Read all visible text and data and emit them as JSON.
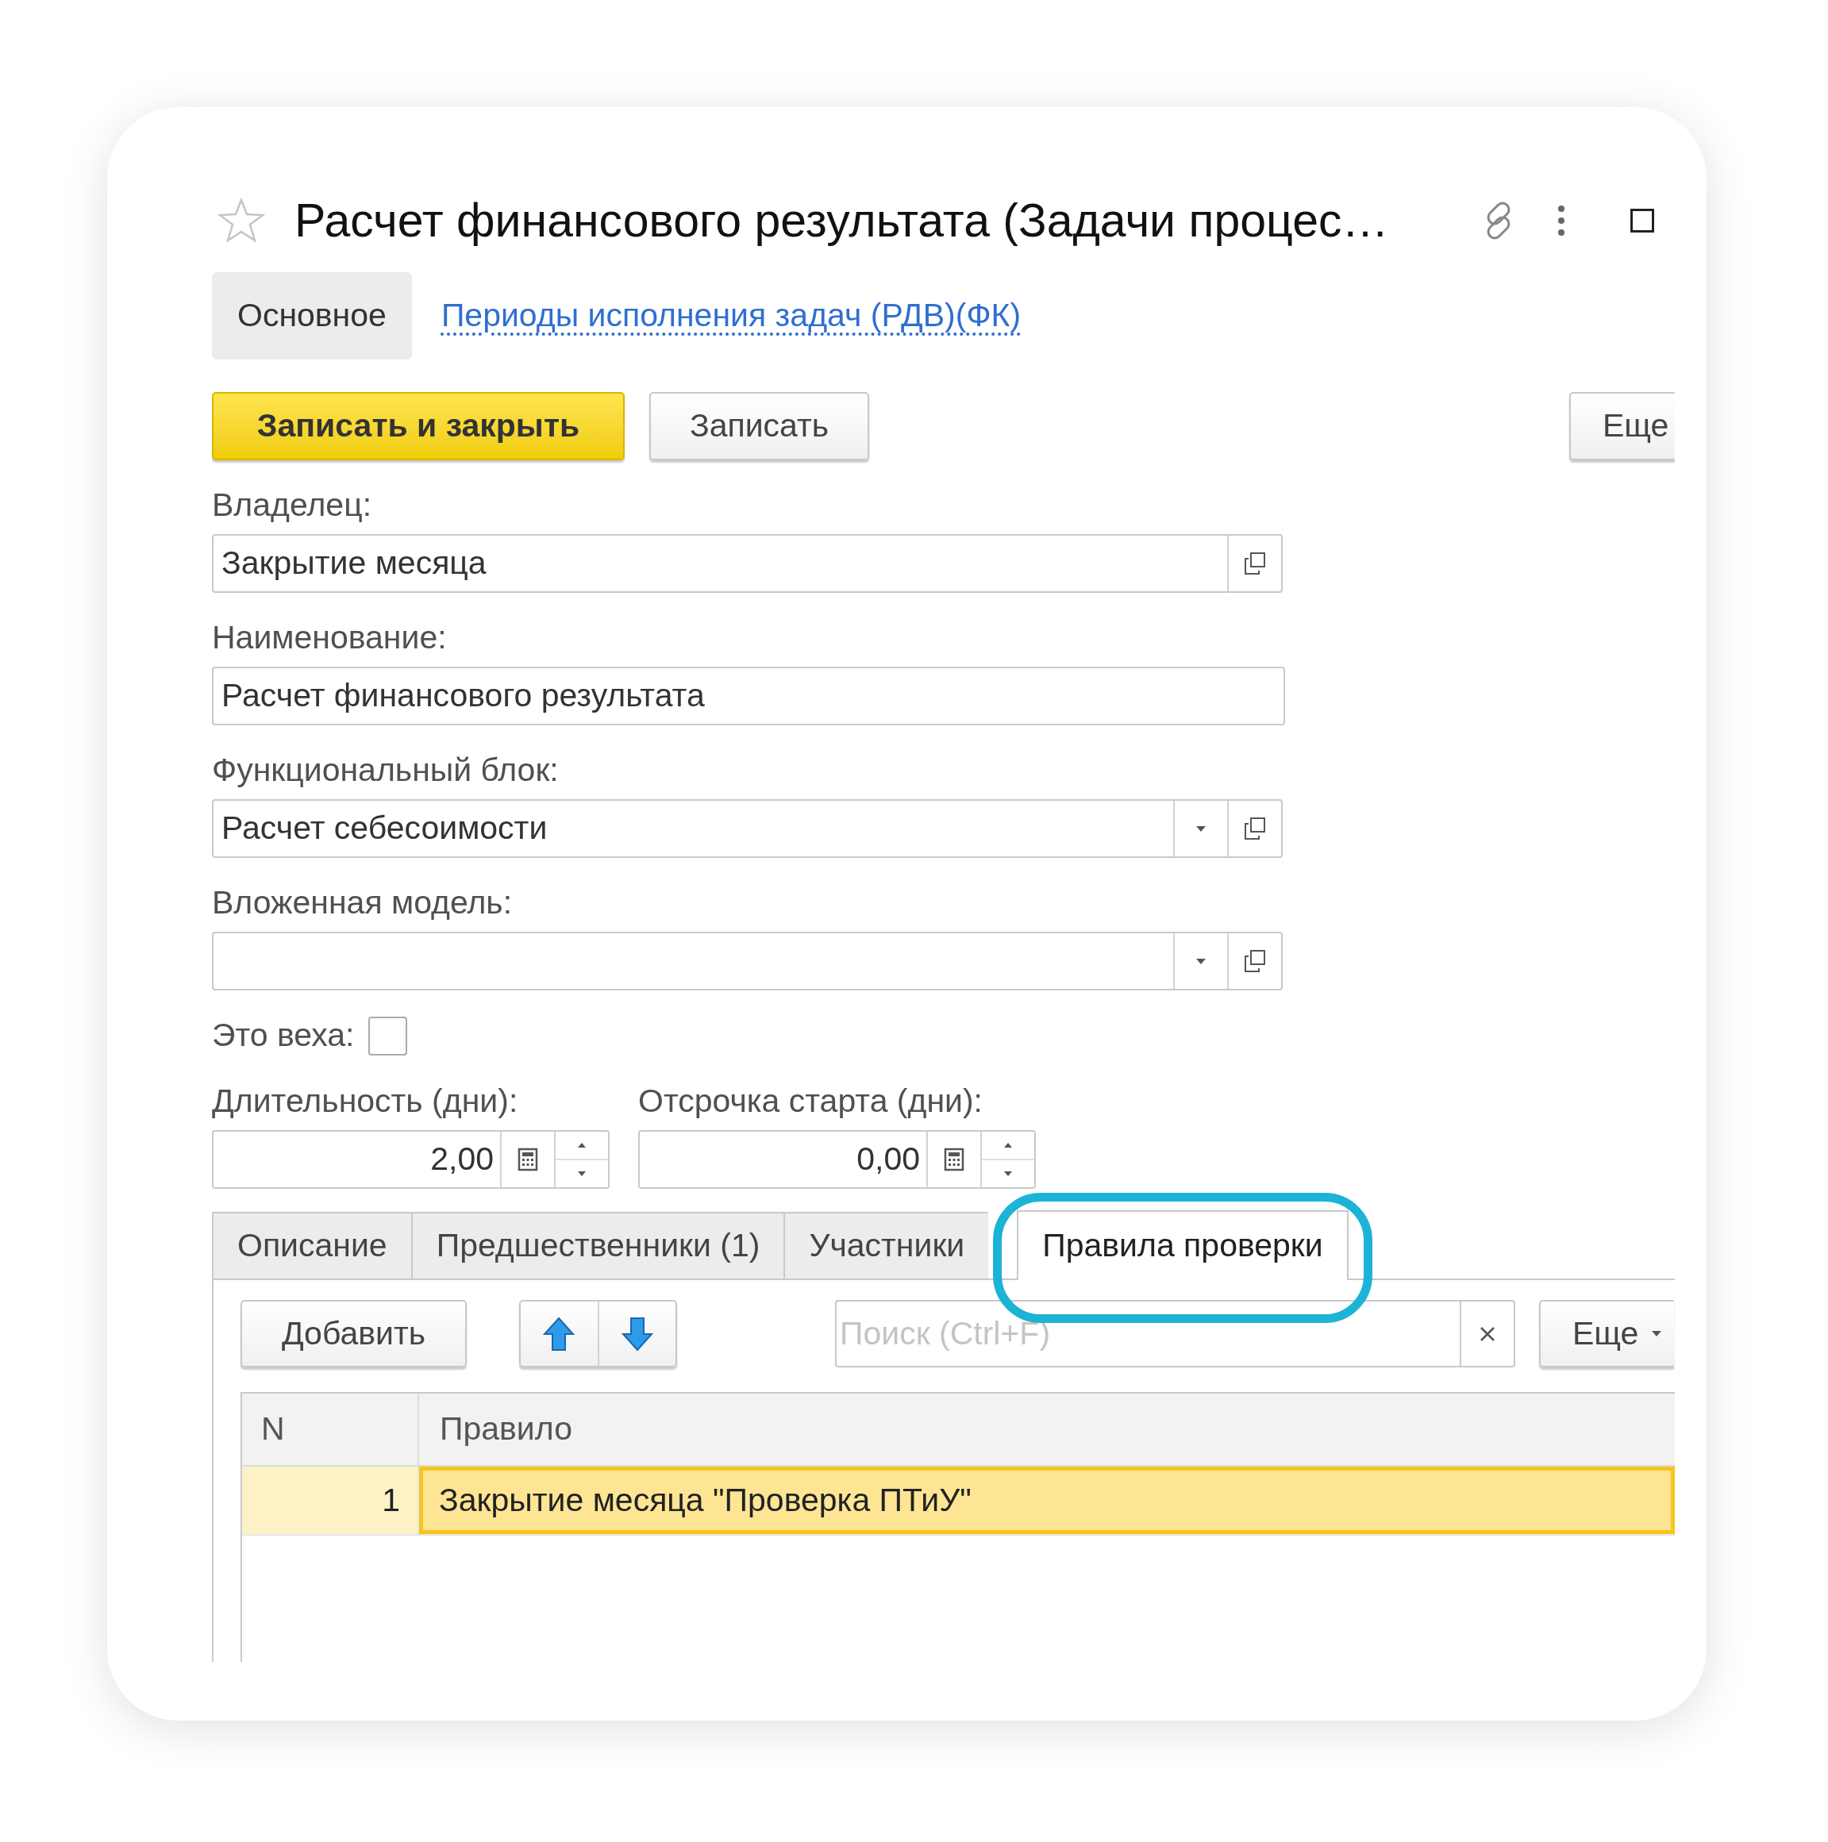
{
  "window": {
    "title": "Расчет финансового результата (Задачи процес…"
  },
  "nav_tabs": [
    {
      "label": "Основное",
      "selected": true
    },
    {
      "label": "Периоды исполнения задач (РДВ)(ФК)",
      "selected": false
    }
  ],
  "command_bar": {
    "buttons": [
      {
        "label": "Записать и закрыть",
        "kind": "primary"
      },
      {
        "label": "Записать",
        "kind": "default"
      }
    ],
    "more": "Еще"
  },
  "fields": [
    {
      "label": "Владелец:",
      "value": "Закрытие месяца",
      "kind": "reference"
    },
    {
      "label": "Наименование:",
      "value": "Расчет финансового результата",
      "kind": "text"
    },
    {
      "label": "Функциональный блок:",
      "value": "Расчет себесоимости",
      "kind": "select"
    },
    {
      "label": "Вложенная модель:",
      "kind": "select"
    }
  ],
  "milestone": {
    "label": "Это веха:",
    "checked": false
  },
  "numbers": [
    {
      "label": "Длительность (дни):",
      "value": "2,00"
    },
    {
      "label": "Отсрочка старта (дни):",
      "value": "0,00"
    }
  ],
  "tabs": [
    {
      "label": "Описание",
      "selected": false
    },
    {
      "label": "Предшественники (1)",
      "selected": false
    },
    {
      "label": "Участники",
      "selected": false
    },
    {
      "label": "Правила проверки",
      "selected": true
    }
  ],
  "table_toolbar": {
    "add": "Добавить",
    "search_placeholder": "Поиск (Ctrl+F)",
    "more": "Еще"
  },
  "table": {
    "columns": [
      "N",
      "Правило"
    ],
    "rows": [
      {
        "cells": [
          "1",
          "Закрытие месяца \"Проверка ПТиУ\""
        ],
        "selected": true
      }
    ]
  }
}
